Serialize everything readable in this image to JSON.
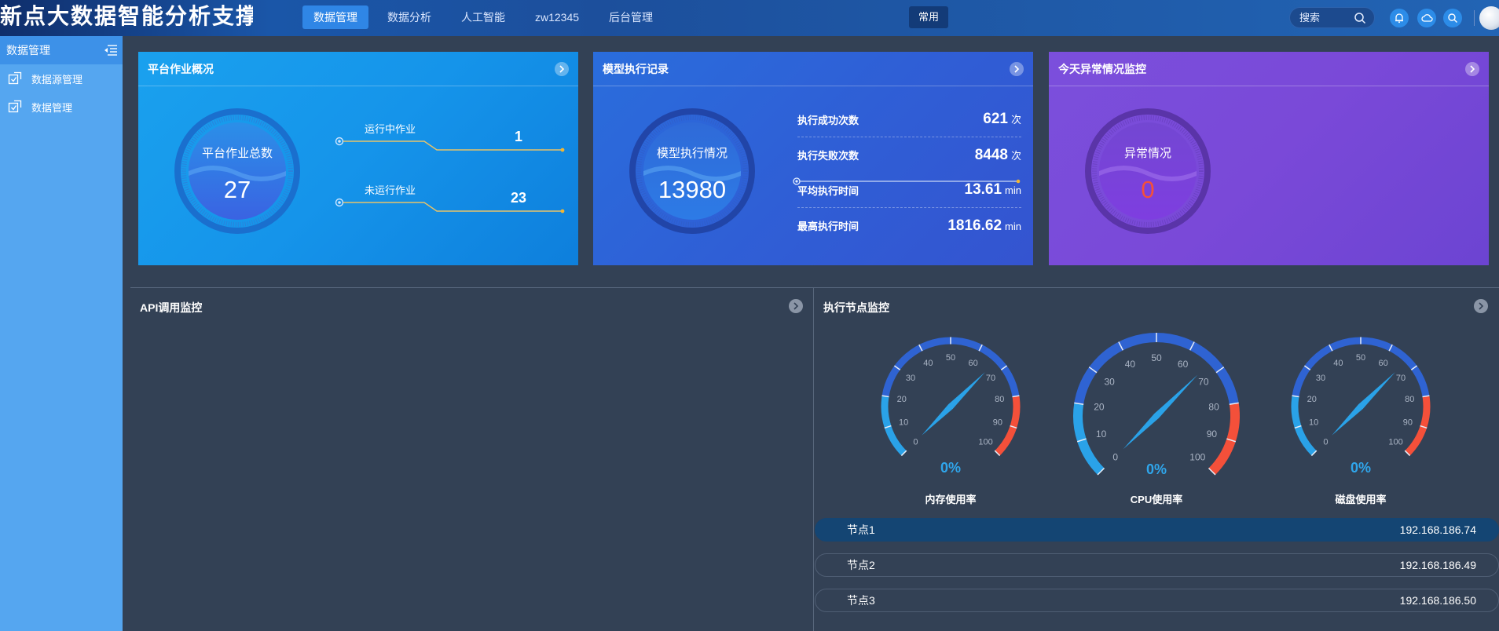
{
  "app": {
    "title": "新点大数据智能分析支撑平台"
  },
  "nav": {
    "items": [
      {
        "label": "数据管理",
        "active": true
      },
      {
        "label": "数据分析",
        "active": false
      },
      {
        "label": "人工智能",
        "active": false
      },
      {
        "label": "zw12345",
        "active": false
      },
      {
        "label": "后台管理",
        "active": false
      }
    ],
    "common_label": "常用",
    "search_placeholder": "搜索",
    "icons": [
      "bell-icon",
      "cloud-icon",
      "search-icon"
    ]
  },
  "sidebar": {
    "title": "数据管理",
    "items": [
      {
        "label": "数据源管理"
      },
      {
        "label": "数据管理"
      }
    ]
  },
  "cards": {
    "platform": {
      "title": "平台作业概况",
      "dial_label": "平台作业总数",
      "dial_value": "27",
      "running_label": "运行中作业",
      "running_value": "1",
      "stopped_label": "未运行作业",
      "stopped_value": "23"
    },
    "model": {
      "title": "模型执行记录",
      "dial_label": "模型执行情况",
      "dial_value": "13980",
      "stats": [
        {
          "label": "执行成功次数",
          "value": "621",
          "unit": "次"
        },
        {
          "label": "执行失败次数",
          "value": "8448",
          "unit": "次"
        },
        {
          "label": "平均执行时间",
          "value": "13.61",
          "unit": "min"
        },
        {
          "label": "最高执行时间",
          "value": "1816.62",
          "unit": "min"
        }
      ]
    },
    "anomaly": {
      "title": "今天异常情况监控",
      "dial_label": "异常情况",
      "dial_value": "0"
    }
  },
  "api_panel": {
    "title": "API调用监控"
  },
  "node_panel": {
    "title": "执行节点监控",
    "gauges": [
      {
        "name": "内存使用率",
        "value": "0%",
        "percent": 0
      },
      {
        "name": "CPU使用率",
        "value": "0%",
        "percent": 0
      },
      {
        "name": "磁盘使用率",
        "value": "0%",
        "percent": 0
      }
    ],
    "gauge_ticks": [
      "0",
      "10",
      "20",
      "30",
      "40",
      "50",
      "60",
      "70",
      "80",
      "90",
      "100"
    ],
    "nodes": [
      {
        "name": "节点1",
        "ip": "192.168.186.74",
        "active": true
      },
      {
        "name": "节点2",
        "ip": "192.168.186.49",
        "active": false
      },
      {
        "name": "节点3",
        "ip": "192.168.186.50",
        "active": false
      }
    ]
  },
  "colors": {
    "page_bg": "#334155",
    "accent": "#2f86e6",
    "danger": "#f4503a",
    "gauge_blue": "#2aa2e8"
  }
}
